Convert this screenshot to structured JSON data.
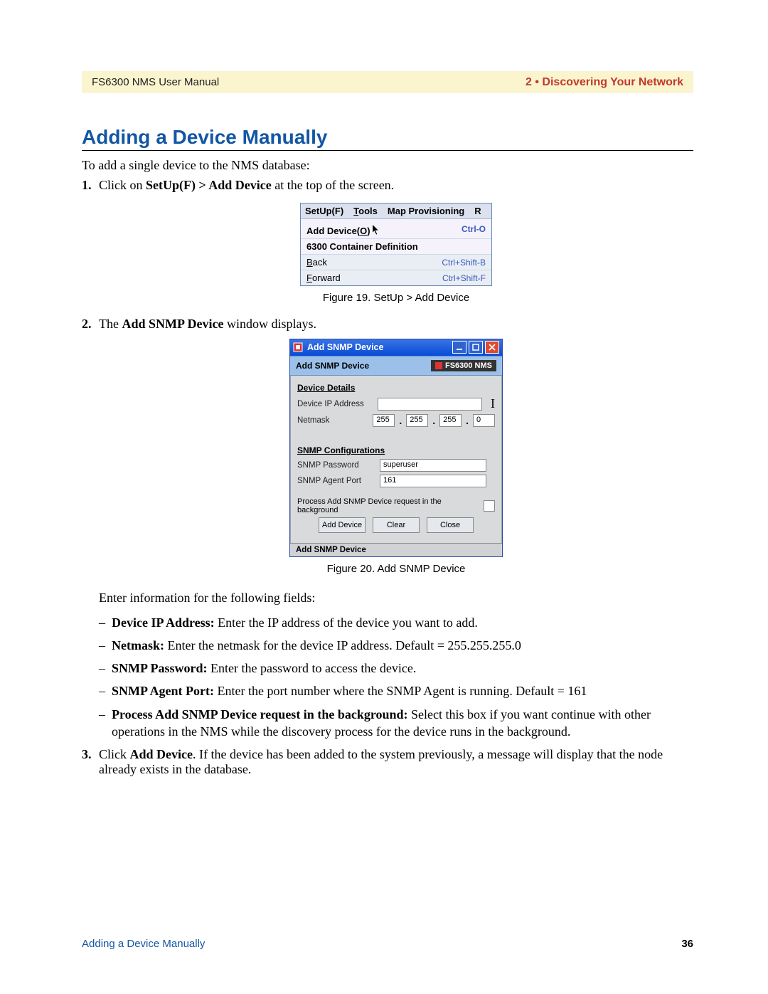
{
  "header": {
    "left": "FS6300 NMS User Manual",
    "right": "2 • Discovering Your Network"
  },
  "section_title": "Adding a Device Manually",
  "intro": "To add a single device to the NMS database:",
  "step1": {
    "num": "1.",
    "pre": "Click on ",
    "bold": "SetUp(F) > Add Device",
    "post": " at the top of the screen."
  },
  "fig19": {
    "caption": "Figure 19. SetUp > Add Device",
    "menubar": {
      "setup": "SetUp(F)",
      "tools": "Tools",
      "map": "Map Provisioning",
      "r": "R"
    },
    "items": [
      {
        "label": "Add Device(O)",
        "shortcut": "Ctrl-O",
        "hl": true,
        "mnemonic": 11
      },
      {
        "label": "6300 Container Definition",
        "shortcut": "",
        "hl": true
      },
      {
        "label": "Back",
        "shortcut": "Ctrl+Shift-B",
        "mnemonic": 0
      },
      {
        "label": "Forward",
        "shortcut": "Ctrl+Shift-F",
        "mnemonic": 0
      }
    ]
  },
  "step2": {
    "num": "2.",
    "pre": "The ",
    "bold": "Add SNMP Device",
    "post": " window displays."
  },
  "fig20": {
    "titlebar": "Add SNMP Device",
    "subhead_left": "Add SNMP Device",
    "subhead_logo": "FS6300 NMS",
    "grp_details": "Device Details",
    "lbl_ip": "Device IP Address",
    "lbl_mask": "Netmask",
    "mask": [
      "255",
      "255",
      "255",
      "0"
    ],
    "grp_snmp": "SNMP Configurations",
    "lbl_pwd": "SNMP Password",
    "val_pwd": "superuser",
    "lbl_port": "SNMP Agent Port",
    "val_port": "161",
    "bg_label": "Process Add SNMP Device request in the background",
    "btn_add": "Add Device",
    "btn_clear": "Clear",
    "btn_close": "Close",
    "status": "Add SNMP Device",
    "caption": "Figure 20. Add SNMP Device"
  },
  "enter_info": "Enter information for the following fields:",
  "fields": {
    "ip": {
      "b": "Device IP Address:",
      "t": " Enter the IP address of the device you want to add."
    },
    "mask": {
      "b": "Netmask:",
      "t": " Enter the netmask for the device IP address. Default = 255.255.255.0"
    },
    "pwd": {
      "b": "SNMP Password:",
      "t": " Enter the password to access the device."
    },
    "port": {
      "b": "SNMP Agent Port:",
      "t": " Enter the port number where the SNMP Agent is running. Default = 161"
    },
    "bg": {
      "b": "Process Add SNMP Device request in the background:",
      "t": " Select this box if you want continue with other operations in the NMS while the discovery process for the device runs in the background."
    }
  },
  "step3": {
    "num": "3.",
    "pre": "Click ",
    "bold": "Add Device",
    "post": ". If the device has been added to the system previously, a message will display that the node already exists in the database."
  },
  "footer": {
    "left": "Adding a Device Manually",
    "right": "36"
  }
}
